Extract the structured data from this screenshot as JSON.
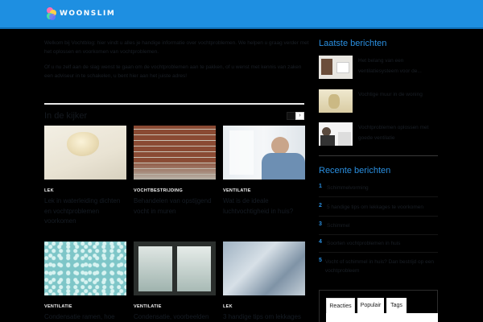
{
  "site": {
    "logo_text": "WOONSLIM"
  },
  "intro": {
    "paragraph1": "Welkom bij Vochtblog: hier vindt u alles je handige informatie over vochtproblemen. We helpen u graag verder met het oplossen en voorkomen van vochtproblemen.",
    "paragraph2": "Of u nu zelf aan de slag wenst te gaan om de vochtproblemen aan te pakken, of u wenst met kennis van zaken een adviseur in te schakelen, u bent hier aan het juiste adres!"
  },
  "section": {
    "title": "In de kijker",
    "prev_icon": "chevron-left-icon",
    "next_icon": "chevron-right-icon",
    "next_label": "›"
  },
  "cards": [
    {
      "category": "LEK",
      "title": "Lek in waterleiding dichten en vochtproblemen voorkomen"
    },
    {
      "category": "VOCHTBESTRIJDING",
      "title": "Behandelen van opstijgend vocht in muren"
    },
    {
      "category": "VENTILATIE",
      "title": "Wat is de ideale luchtvochtigheid in huis?"
    },
    {
      "category": "VENTILATIE",
      "title": "Condensatie ramen, hoe"
    },
    {
      "category": "VENTILATIE",
      "title": "Condensatie, voorbeelden"
    },
    {
      "category": "LEK",
      "title": "3 handige tips om lekkages"
    }
  ],
  "sidebar": {
    "latest_title": "Laatste berichten",
    "latest": [
      {
        "title": "Het belang van een ventilatiesysteem voor de..."
      },
      {
        "title": "Vochtige muur in de woning"
      },
      {
        "title": "Vochtproblemen oplossen met goede ventilatie"
      }
    ],
    "recent_title": "Recente berichten",
    "recent": [
      {
        "num": "1",
        "text": "Schimmelvorming"
      },
      {
        "num": "2",
        "text": "5 handige tips om lekkages te voorkomen"
      },
      {
        "num": "3",
        "text": "Schimmel"
      },
      {
        "num": "4",
        "text": "Soorten vochtproblemen in huis"
      },
      {
        "num": "5",
        "text": "Vocht of schimmel in huis? Dan bestrijd op een vochtprobleem"
      }
    ],
    "tabs": [
      "Reacties",
      "Populair",
      "Tags"
    ]
  },
  "colors": {
    "header": "#1e8fe1",
    "accent": "#2a8fe0",
    "background": "#000000"
  }
}
